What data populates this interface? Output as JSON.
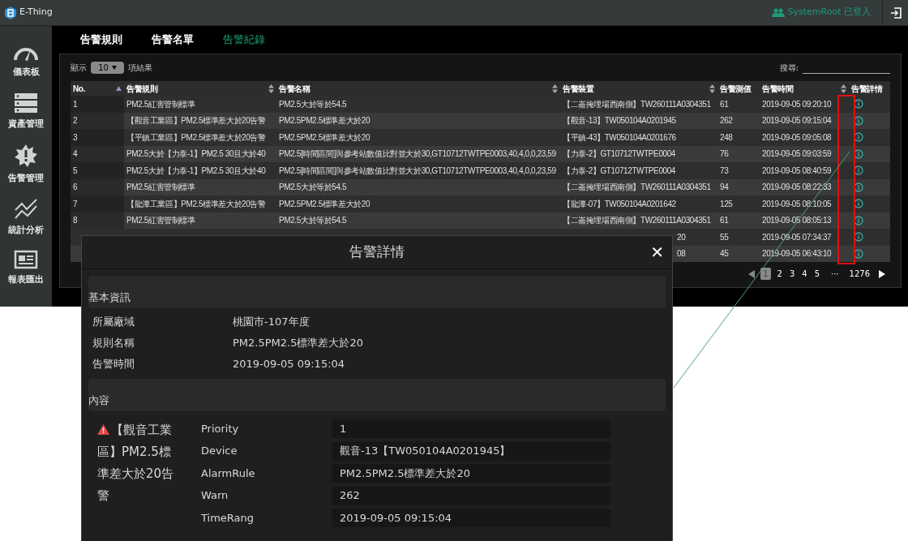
{
  "app": {
    "title": "E-Thing",
    "user": "SystemRoot 已登入"
  },
  "sidebar": {
    "items": [
      {
        "label": "儀表板",
        "kind": "gauge"
      },
      {
        "label": "資產管理",
        "kind": "server"
      },
      {
        "label": "告警管理",
        "kind": "alert"
      },
      {
        "label": "統計分析",
        "kind": "chart"
      },
      {
        "label": "報表匯出",
        "kind": "report"
      }
    ]
  },
  "tabs": [
    {
      "label": "告警規則",
      "selected": false
    },
    {
      "label": "告警名單",
      "selected": false
    },
    {
      "label": "告警紀錄",
      "selected": true
    }
  ],
  "length": {
    "before": "顯示",
    "value": "10",
    "after": "項結果"
  },
  "search": {
    "label": "搜尋:"
  },
  "table": {
    "columns": [
      {
        "label": "No.",
        "sortable": true,
        "ascending": true
      },
      {
        "label": "告警規則",
        "sortable": true,
        "ascending": false
      },
      {
        "label": "告警名稱",
        "sortable": true,
        "ascending": false
      },
      {
        "label": "告警裝置",
        "sortable": true,
        "ascending": false
      },
      {
        "label": "告警測值",
        "sortable": false
      },
      {
        "label": "告警時間",
        "sortable": true,
        "ascending": false
      },
      {
        "label": "告警詳情",
        "sortable": false
      }
    ],
    "rows": [
      {
        "no": "1",
        "rule": "PM2.5紅害管制標準",
        "name": "PM2.5大於等於54.5",
        "device": "【二崙掩埋場西南側】TW260111A0304351",
        "value": "61",
        "time": "2019-09-05 09:20:10"
      },
      {
        "no": "2",
        "rule": "【觀音工業區】PM2.5標準差大於20告警",
        "name": "PM2.5PM2.5標準差大於20",
        "device": "【觀音-13】TW050104A0201945",
        "value": "262",
        "time": "2019-09-05 09:15:04"
      },
      {
        "no": "3",
        "rule": "【平鎮工業區】PM2.5標準差大於20告警",
        "name": "PM2.5PM2.5標準差大於20",
        "device": "【平鎮-43】TW050104A0201676",
        "value": "248",
        "time": "2019-09-05 09:05:08"
      },
      {
        "no": "4",
        "rule": "PM2.5大於【力泰-1】PM2.5 30且大於40",
        "name": "PM2.5[時間區間]與參考站數值比對並大於30,GT10712TWTPE0003,40,4,0,0,23,59",
        "device": "【力泰-2】GT10712TWTPE0004",
        "value": "76",
        "time": "2019-09-05 09:03:59"
      },
      {
        "no": "5",
        "rule": "PM2.5大於【力泰-1】PM2.5 30且大於40",
        "name": "PM2.5[時間區間]與參考站數值比對並大於30,GT10712TWTPE0003,40,4,0,0,23,59",
        "device": "【力泰-2】GT10712TWTPE0004",
        "value": "73",
        "time": "2019-09-05 08:40:59"
      },
      {
        "no": "6",
        "rule": "PM2.5紅害管制標準",
        "name": "PM2.5大於等於54.5",
        "device": "【二崙掩埋場西南側】TW260111A0304351",
        "value": "94",
        "time": "2019-09-05 08:22:33"
      },
      {
        "no": "7",
        "rule": "【龍潭工業區】PM2.5標準差大於20告警",
        "name": "PM2.5PM2.5標準差大於20",
        "device": "【龍潭-07】TW050104A0201642",
        "value": "125",
        "time": "2019-09-05 08:10:05"
      },
      {
        "no": "8",
        "rule": "PM2.5紅害管制標準",
        "name": "PM2.5大於等於54.5",
        "device": "【二崙掩埋場西南側】TW260111A0304351",
        "value": "61",
        "time": "2019-09-05 08:05:13"
      },
      {
        "device_tail": "20",
        "value": "55",
        "time": "2019-09-05 07:34:37"
      },
      {
        "device_tail": "08",
        "value": "45",
        "time": "2019-09-05 06:43:10"
      }
    ]
  },
  "pagination": {
    "pages": [
      {
        "label": "1",
        "selected": true
      },
      {
        "label": "2",
        "selected": false
      },
      {
        "label": "3",
        "selected": false
      },
      {
        "label": "4",
        "selected": false
      },
      {
        "label": "5",
        "selected": false
      }
    ],
    "ellipsis": "···",
    "last": "1276"
  },
  "dialog": {
    "title": "告警詳情",
    "close": "✕",
    "basic": {
      "heading": "基本資訊",
      "fields": [
        {
          "label": "所屬廠域",
          "value": "桃園市-107年度"
        },
        {
          "label": "規則名稱",
          "value": "PM2.5PM2.5標準差大於20"
        },
        {
          "label": "告警時間",
          "value": "2019-09-05 09:15:04"
        }
      ]
    },
    "content": {
      "heading": "內容",
      "alert": "【觀音工業區】PM2.5標準差大於20告警",
      "fields": [
        {
          "label": "Priority",
          "value": "1"
        },
        {
          "label": "Device",
          "value": "觀音-13【TW050104A0201945】"
        },
        {
          "label": "AlarmRule",
          "value": "PM2.5PM2.5標準差大於20"
        },
        {
          "label": "Warn",
          "value": "262"
        },
        {
          "label": "TimeRang",
          "value": "2019-09-05 09:15:04"
        }
      ]
    }
  }
}
